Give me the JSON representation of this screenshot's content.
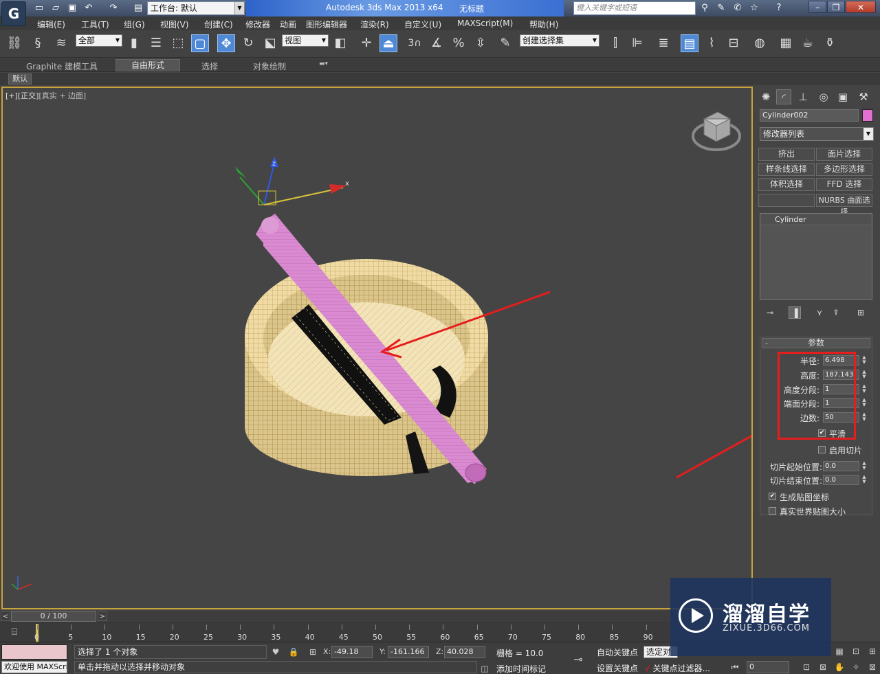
{
  "title_bar": {
    "workspace_label": "工作台: 默认",
    "app_name": "Autodesk 3ds Max  2013 x64",
    "document_name": "无标题",
    "search_placeholder": "键入关键字或短语"
  },
  "menu": [
    "编辑(E)",
    "工具(T)",
    "组(G)",
    "视图(V)",
    "创建(C)",
    "修改器",
    "动画",
    "图形编辑器",
    "渲染(R)",
    "自定义(U)",
    "MAXScript(M)",
    "帮助(H)"
  ],
  "toolbar": {
    "selection_filter": "全部",
    "reference_coord": "视图",
    "named_selection": "创建选择集",
    "snap_value": "3"
  },
  "ribbon": {
    "tabs": [
      "Graphite 建模工具",
      "自由形式",
      "选择",
      "对象绘制"
    ],
    "active_tab": "自由形式",
    "sub_label": "默认"
  },
  "viewport": {
    "label_parts": [
      "[+]",
      "[正交]",
      "[真实 + 边面]"
    ],
    "gizmo_axes": [
      "x",
      "z"
    ],
    "selected_color": "#e36fd2"
  },
  "command_panel": {
    "object_name": "Cylinder002",
    "object_color": "#e36fd2",
    "modifier_list": "修改器列表",
    "modifier_buttons": [
      "挤出",
      "面片选择",
      "样条线选择",
      "多边形选择",
      "体积选择",
      "FFD 选择",
      "",
      "NURBS 曲面选择"
    ],
    "stack_items": [
      "Cylinder"
    ],
    "rollout_title": "参数",
    "rollout_collapse": "-",
    "params": [
      {
        "label": "半径:",
        "value": "6.498"
      },
      {
        "label": "高度:",
        "value": "187.143"
      },
      {
        "label": "高度分段:",
        "value": "1"
      },
      {
        "label": "端面分段:",
        "value": "1"
      },
      {
        "label": "边数:",
        "value": "50"
      }
    ],
    "smooth": {
      "label": "平滑",
      "checked": true
    },
    "slice": {
      "label": "启用切片",
      "checked": false
    },
    "slice_from": {
      "label": "切片起始位置:",
      "value": "0.0"
    },
    "slice_to": {
      "label": "切片结束位置:",
      "value": "0.0"
    },
    "gen_mapping": {
      "label": "生成贴图坐标",
      "checked": true
    },
    "real_world": {
      "label": "真实世界贴图大小",
      "checked": false
    }
  },
  "timeline": {
    "frame_counter": "0 / 100",
    "ticks": [
      "0",
      "5",
      "10",
      "15",
      "20",
      "25",
      "30",
      "35",
      "40",
      "45",
      "50",
      "55",
      "60",
      "65",
      "70",
      "75",
      "80",
      "85",
      "90"
    ]
  },
  "status_bar": {
    "selection_status": "选择了 1 个对象",
    "prompt": "单击并拖动以选择并移动对象",
    "listener_text": "欢迎使用 MAXScri",
    "x_value": "-49.18",
    "y_value": "-161.166",
    "z_value": "40.028",
    "grid": "栅格 = 10.0",
    "add_time_tag": "添加时间标记",
    "auto_key": "自动关键点",
    "set_key": "设置关键点",
    "selection_dd": "选定对",
    "key_filter": "关键点过滤器...",
    "current_frame": "0"
  },
  "watermark": {
    "title": "溜溜自学",
    "url": "ZIXUE.3D66.COM"
  }
}
